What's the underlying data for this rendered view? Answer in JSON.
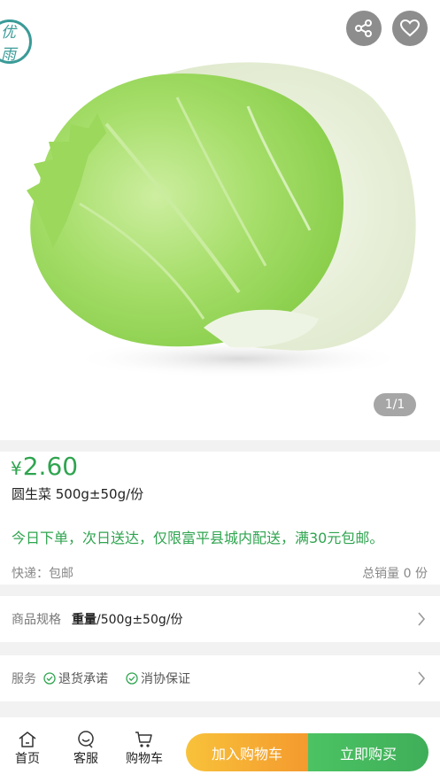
{
  "brand": {
    "logo_text": "优雨"
  },
  "gallery": {
    "counter": "1/1"
  },
  "product": {
    "currency": "¥",
    "price": "2.60",
    "name": "圆生菜 500g±50g/份",
    "promo": "今日下单，次日送达，仅限富平县城内配送，满30元包邮。",
    "shipping": "快递：包邮",
    "sales": "总销量 0 份"
  },
  "spec": {
    "label": "商品规格",
    "value_bold": "重量",
    "value_rest": "/500g±50g/份"
  },
  "service": {
    "label": "服务",
    "items": [
      "退货承诺",
      "消协保证"
    ]
  },
  "bottom_nav": {
    "home": "首页",
    "service": "客服",
    "cart": "购物车",
    "add_to_cart": "加入购物车",
    "buy_now": "立即购买"
  },
  "colors": {
    "accent_green": "#2fa44f",
    "cart_orange": "#f49a2e",
    "buy_green": "#3fae59"
  },
  "icons": [
    "share-icon",
    "heart-icon",
    "check-circle-icon",
    "chevron-right-icon",
    "home-icon",
    "chat-icon",
    "cart-icon"
  ]
}
